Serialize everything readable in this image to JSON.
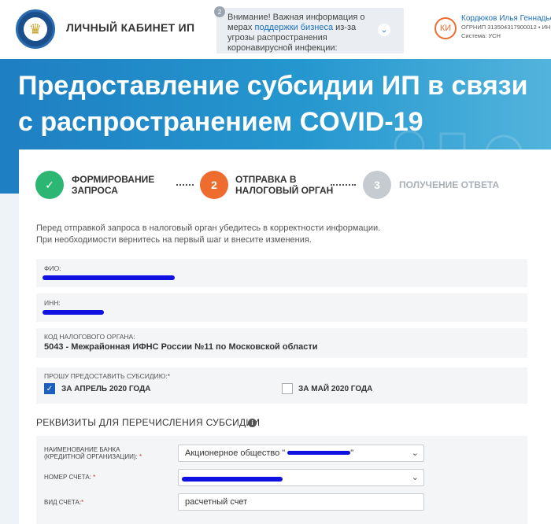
{
  "header": {
    "app_title": "ЛИЧНЫЙ КАБИНЕТ ИП",
    "notice_count": "2",
    "notice_text_before": "Внимание! Важная информация о мерах ",
    "notice_link": "поддержки бизнеса",
    "notice_text_after": " из-за угрозы распространения коронавирусной инфекции:",
    "user_initials": "КИ",
    "user_name": "Кордюков Илья Геннадье",
    "user_ogrnip": "ОГРНИП 313504317900012 • ИН",
    "user_system": "Система: УСН"
  },
  "banner": {
    "title": "Предоставление субсидии ИП в связи с распространением COVID-19"
  },
  "steps": [
    {
      "number": "✓",
      "label_line1": "Формирование",
      "label_line2": "запроса",
      "state": "done"
    },
    {
      "number": "2",
      "label_line1": "Отправка в",
      "label_line2": "налоговый орган",
      "state": "active"
    },
    {
      "number": "3",
      "label_line1": "Получение ответа",
      "label_line2": "",
      "state": "pending"
    }
  ],
  "intro": {
    "line1": "Перед отправкой запроса в налоговый орган убедитесь в корректности информации.",
    "line2": "При необходимости вернитесь на первый шаг и внесите изменения."
  },
  "fields": {
    "fio_label": "ФИО:",
    "inn_label": "ИНН:",
    "tax_code_label": "КОД НАЛОГОВОГО ОРГАНА:",
    "tax_code_value": "5043 - Межрайонная ИФНС России №11 по Московской области"
  },
  "subsidy": {
    "label": "ПРОШУ ПРЕДОСТАВИТЬ СУБСИДИЮ:*",
    "april_label": "ЗА АПРЕЛЬ 2020 ГОДА",
    "april_checked": true,
    "may_label": "ЗА МАЙ 2020 ГОДА",
    "may_checked": false
  },
  "requisites": {
    "section_title": "РЕКВИЗИТЫ ДЛЯ ПЕРЕЧИСЛЕНИЯ СУБСИДИИ",
    "bank_label_line1": "НАИМЕНОВАНИЕ БАНКА",
    "bank_label_line2": "(КРЕДИТНОЙ ОРГАНИЗАЦИИ):",
    "bank_value": "Акционерное общество \"",
    "account_label": "НОМЕР СЧЕТА:",
    "account_type_label": "ВИД СЧЕТА:",
    "account_type_value": "расчетный счет"
  },
  "colors": {
    "brand_blue": "#1c6fbe",
    "step_done": "#2bb673",
    "step_active": "#ef6c2f",
    "step_pending": "#c5cbd1",
    "redaction": "#1010e0"
  }
}
